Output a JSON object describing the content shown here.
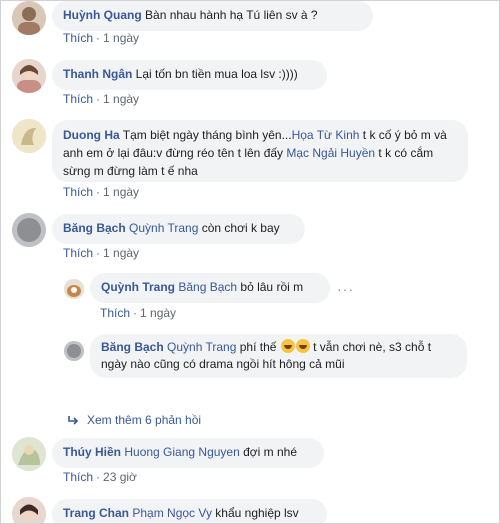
{
  "comments": [
    {
      "author": "Huỳnh Quang",
      "mention": "",
      "text": "Bàn nhau hành hạ Tú liên sv à ?",
      "like": "Thích",
      "time": "1 ngày"
    },
    {
      "author": "Thanh Ngân",
      "mention": "",
      "text": "Lại tốn bn tiền mua loa lsv :))))",
      "like": "Thích",
      "time": "1 ngày"
    },
    {
      "author": "Duong Ha",
      "mention": "",
      "text_a": "Tạm biệt ngày tháng bình yên...",
      "mention_a": "Họa Từ Kinh",
      "text_b": " t k cố ý bỏ m và anh em ở lại đâu:v đừng réo tên t lên đấy ",
      "mention_b": "Mạc Ngải Huyền",
      "text_c": " t k có cắm sừng m đừng làm t ế nha",
      "like": "Thích",
      "time": "1 ngày"
    },
    {
      "author": "Băng Bạch",
      "mention": "Quỳnh Trang",
      "text": " còn chơi k bay",
      "like": "Thích",
      "time": "1 ngày"
    },
    {
      "author": "Quỳnh Trang",
      "mention": "Băng Bạch",
      "text": " bỏ lâu rồi m",
      "like": "Thích",
      "time": "1 ngày",
      "more": "···"
    },
    {
      "author": "Băng Bạch",
      "mention": "Quỳnh Trang",
      "text_a": " phí thế ",
      "text_b": " t vẫn chơi nè, s3 chỗ t ngày nào cũng có drama ngồi hít hông cả mũi"
    },
    {
      "author": "Thúy Hiền",
      "mention": "Huong Giang Nguyen",
      "text": " đợi m nhé",
      "like": "Thích",
      "time": "23 giờ"
    },
    {
      "author": "Trang Chan",
      "mention": "Phạm Ngọc Vy",
      "text": " khẩu nghiệp lsv"
    }
  ],
  "view_more": {
    "icon": "reply-arrow-icon",
    "label": "Xem thêm 6 phản hồi"
  },
  "colors": {
    "link": "#385898",
    "bubble": "#f2f3f5",
    "meta": "#606770"
  }
}
